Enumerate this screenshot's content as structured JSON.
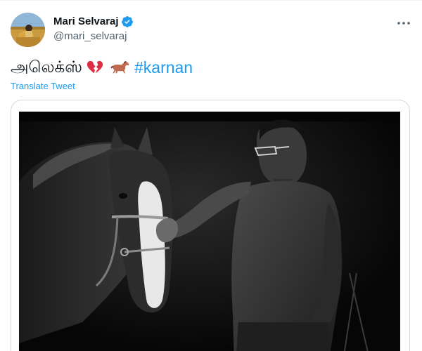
{
  "author": {
    "display_name": "Mari Selvaraj",
    "handle": "@mari_selvaraj",
    "verified": true
  },
  "tweet": {
    "text": "அலெக்ஸ்",
    "emojis": [
      "broken-heart-icon",
      "horse-icon"
    ],
    "hashtag": "#karnan",
    "translate_label": "Translate Tweet"
  },
  "media": {
    "type": "photo",
    "style": "black-and-white"
  },
  "colors": {
    "accent": "#1d9bf0",
    "verified": "#1d9bf0",
    "text": "#0f1419",
    "secondary": "#536471",
    "border": "#cfd9de",
    "broken_heart": "#dd2e44",
    "horse": "#c1694f"
  }
}
